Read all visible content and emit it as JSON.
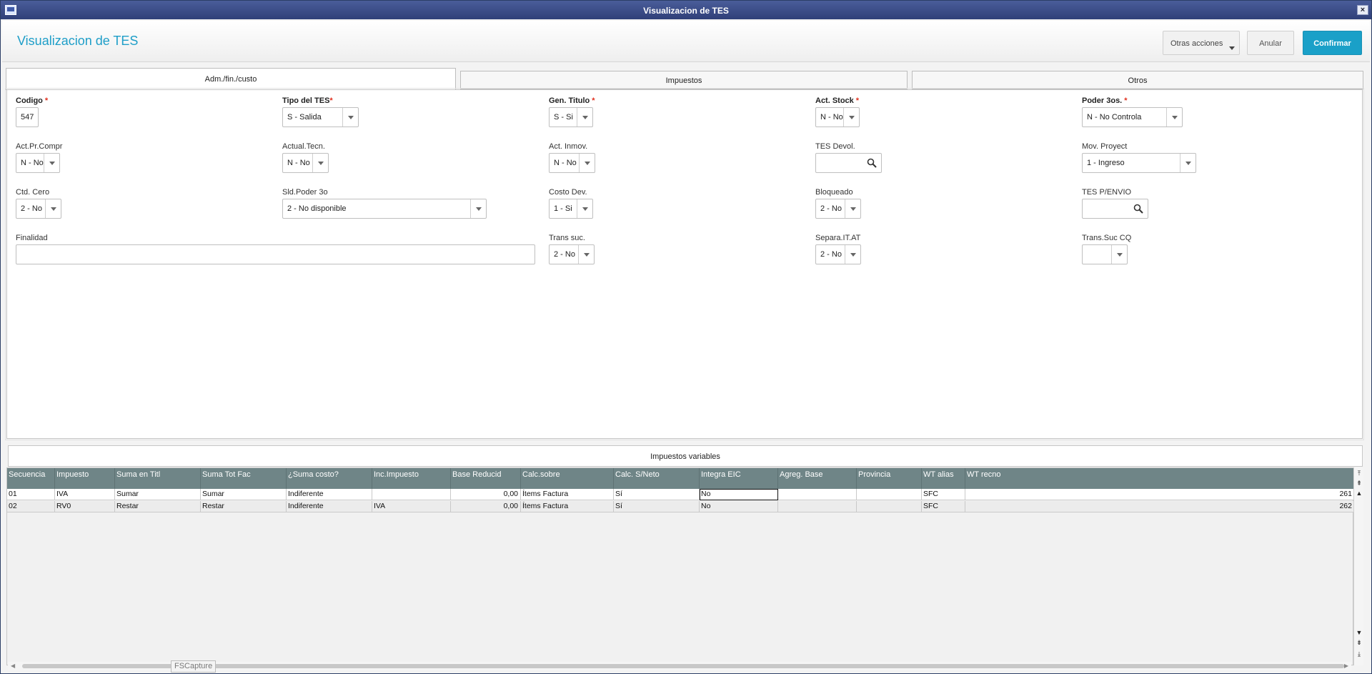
{
  "window": {
    "title": "Visualizacion de TES"
  },
  "header": {
    "title": "Visualizacion de TES",
    "otras_label": "Otras acciones",
    "anular_label": "Anular",
    "confirmar_label": "Confirmar"
  },
  "tabs": [
    {
      "label": "Adm./fin./custo"
    },
    {
      "label": "Impuestos"
    },
    {
      "label": "Otros"
    }
  ],
  "fields": {
    "codigo": {
      "label": "Codigo",
      "value": "547"
    },
    "tipo_tes": {
      "label": "Tipo del TES",
      "value": "S - Salida"
    },
    "gen_titulo": {
      "label": "Gen. Titulo",
      "value": "S - Si"
    },
    "act_stock": {
      "label": "Act. Stock",
      "value": "N - No"
    },
    "poder_3os": {
      "label": "Poder 3os.",
      "value": "N - No Controla"
    },
    "act_pr_compr": {
      "label": "Act.Pr.Compr",
      "value": "N - No"
    },
    "actual_tecn": {
      "label": "Actual.Tecn.",
      "value": "N - No"
    },
    "act_inmov": {
      "label": "Act. Inmov.",
      "value": "N - No"
    },
    "tes_devol": {
      "label": "TES Devol.",
      "value": ""
    },
    "mov_proyect": {
      "label": "Mov. Proyect",
      "value": "1 - Ingreso"
    },
    "ctd_cero": {
      "label": "Ctd. Cero",
      "value": "2 - No"
    },
    "sld_poder": {
      "label": "Sld.Poder 3o",
      "value": "2 - No disponible"
    },
    "costo_dev": {
      "label": "Costo Dev.",
      "value": "1 - Si"
    },
    "bloqueado": {
      "label": "Bloqueado",
      "value": "2 - No"
    },
    "tes_penvio": {
      "label": "TES P/ENVIO",
      "value": ""
    },
    "finalidad": {
      "label": "Finalidad",
      "value": ""
    },
    "trans_suc": {
      "label": "Trans suc.",
      "value": "2 - No"
    },
    "separa_it": {
      "label": "Separa.IT.AT",
      "value": "2 - No"
    },
    "trans_suc_cq": {
      "label": "Trans.Suc CQ",
      "value": ""
    }
  },
  "grid": {
    "title": "Impuestos variables",
    "columns": [
      "Secuencia",
      "Impuesto",
      "Suma en Titl",
      "Suma Tot Fac",
      "¿Suma costo?",
      "Inc.Impuesto",
      "Base Reducid",
      "Calc.sobre",
      "Calc. S/Neto",
      "Integra EIC",
      "Agreg. Base",
      "Provincia",
      "WT alias",
      "WT recno"
    ],
    "rows": [
      [
        "01",
        "IVA",
        "Sumar",
        "Sumar",
        "Indiferente",
        "",
        "0,00",
        "Ítems Factura",
        "Sí",
        "No",
        "",
        "",
        "SFC",
        "261"
      ],
      [
        "02",
        "RV0",
        "Restar",
        "Restar",
        "Indiferente",
        "IVA",
        "0,00",
        "Ítems Factura",
        "Sí",
        "No",
        "",
        "",
        "SFC",
        "262"
      ]
    ]
  },
  "overlay": {
    "fscapture": "FSCapture"
  }
}
